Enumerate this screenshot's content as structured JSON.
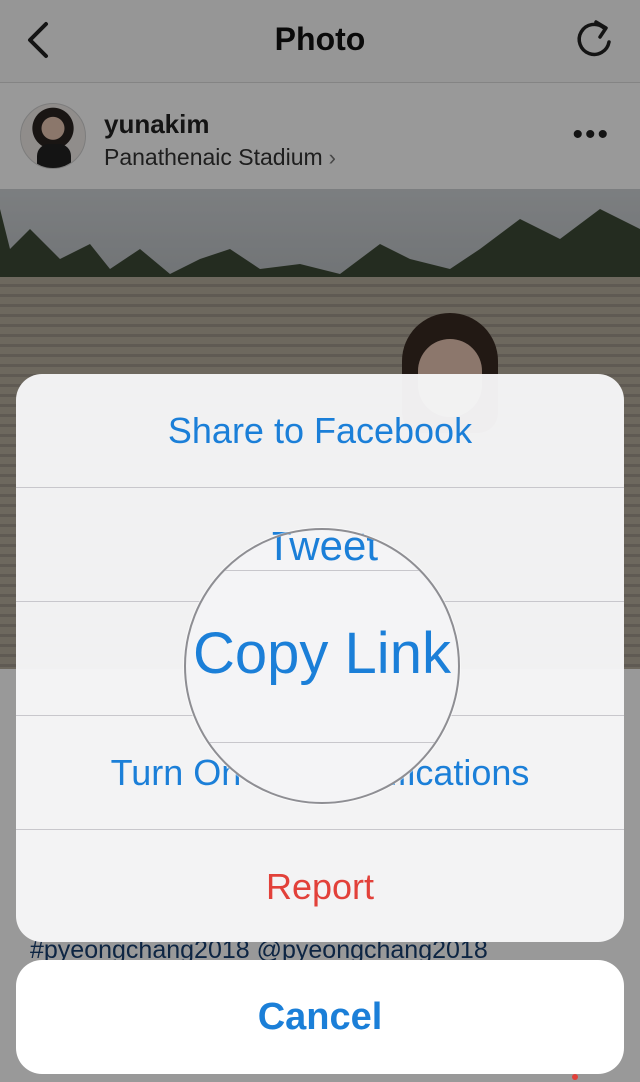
{
  "navbar": {
    "title": "Photo",
    "back_icon": "chevron-left-icon",
    "refresh_icon": "refresh-icon"
  },
  "post": {
    "username": "yunakim",
    "location": "Panathenaic Stadium",
    "location_chevron": "›",
    "more_icon": "ellipsis-icon",
    "more_glyph": "•••",
    "hashtags": "#pyeongchang2018 @pyeongchang2018"
  },
  "action_sheet": {
    "items": [
      {
        "label": "Share to Facebook"
      },
      {
        "label": "Tweet"
      },
      {
        "label": "Copy Link"
      },
      {
        "label": "Turn On Post Notifications"
      },
      {
        "label": "Report"
      }
    ],
    "cancel_label": "Cancel"
  },
  "magnifier": {
    "text": "Copy Link",
    "top_text": "Tweet"
  },
  "colors": {
    "accent": "#1b7fd8",
    "destructive": "#e2413a"
  }
}
